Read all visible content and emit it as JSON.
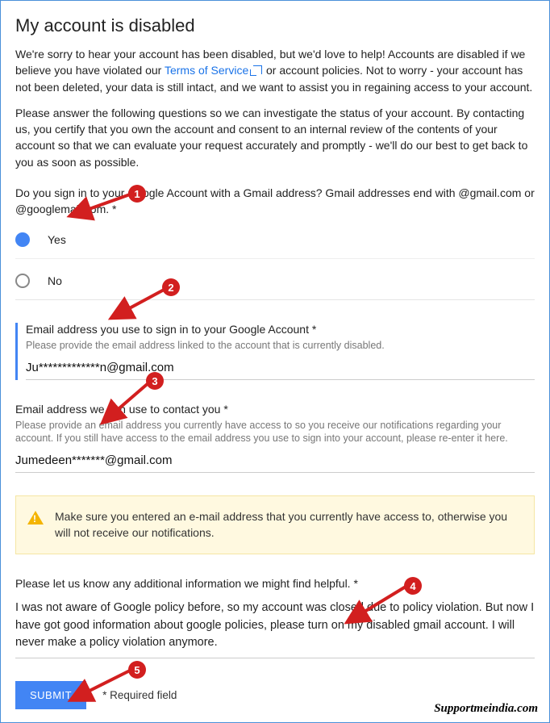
{
  "header": {
    "title": "My account is disabled"
  },
  "intro": {
    "p1_pre": "We're sorry to hear your account has been disabled, but we'd love to help! Accounts are disabled if we believe you have violated our ",
    "tos_label": "Terms of Service",
    "p1_post": " or account policies. Not to worry - your account has not been deleted, your data is still intact, and we want to assist you in regaining access to your account.",
    "p2": "Please answer the following questions so we can investigate the status of your account. By contacting us, you certify that you own the account and consent to an internal review of the contents of your account so that we can evaluate your request accurately and promptly - we'll do our best to get back to you as soon as possible."
  },
  "q_signin": {
    "text": "Do you sign in to your Google Account with a Gmail address? Gmail addresses end with @gmail.com or @googlemail.com. *",
    "yes": "Yes",
    "no": "No"
  },
  "field_signin_email": {
    "label": "Email address you use to sign in to your Google Account *",
    "hint": "Please provide the email address linked to the account that is currently disabled.",
    "value": "Ju*************n@gmail.com"
  },
  "field_contact_email": {
    "label": "Email address we can use to contact you *",
    "hint": "Please provide an email address you currently have access to so you receive our notifications regarding your account. If you still have access to the email address you use to sign into your account, please re-enter it here.",
    "value": "Jumedeen*******@gmail.com"
  },
  "alert": {
    "text": "Make sure you entered an e-mail address that you currently have access to, otherwise you will not receive our notifications."
  },
  "field_additional": {
    "label": "Please let us know any additional information we might find helpful. *",
    "value": "I was not aware of Google policy before, so my account was closed due to policy violation. But now I have got good information about google policies, please turn on my disabled gmail account. I will never make a policy violation anymore."
  },
  "footer": {
    "submit": "SUBMIT",
    "required": "* Required field"
  },
  "watermark": "Supportmeindia.com",
  "annotations": {
    "b1": "1",
    "b2": "2",
    "b3": "3",
    "b4": "4",
    "b5": "5"
  }
}
